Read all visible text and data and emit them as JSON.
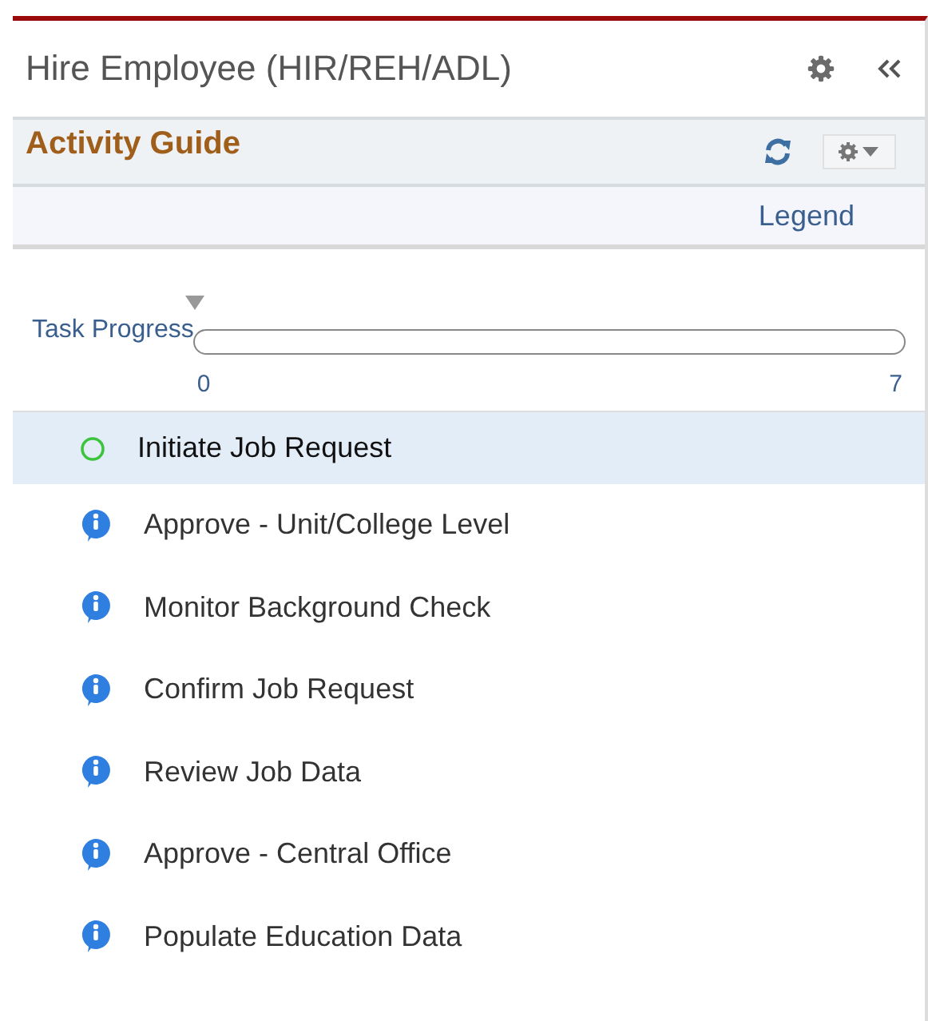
{
  "header": {
    "title": "Hire Employee (HIR/REH/ADL)"
  },
  "guide": {
    "title": "Activity Guide"
  },
  "legend": {
    "label": "Legend"
  },
  "progress": {
    "label": "Task Progress",
    "level": 0,
    "min": "0",
    "max": "7"
  },
  "tasks": [
    {
      "label": "Initiate Job Request",
      "kind": "current",
      "selected": true
    },
    {
      "label": "Approve - Unit/College Level",
      "kind": "info",
      "selected": false
    },
    {
      "label": "Monitor Background Check",
      "kind": "info",
      "selected": false
    },
    {
      "label": "Confirm Job Request",
      "kind": "info",
      "selected": false
    },
    {
      "label": "Review Job Data",
      "kind": "info",
      "selected": false
    },
    {
      "label": "Approve - Central Office",
      "kind": "info",
      "selected": false
    },
    {
      "label": "Populate Education Data",
      "kind": "info",
      "selected": false
    }
  ]
}
